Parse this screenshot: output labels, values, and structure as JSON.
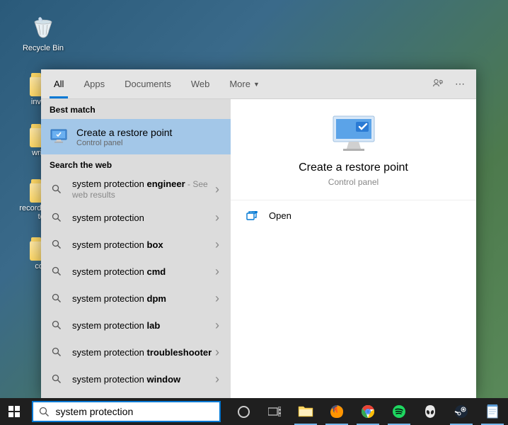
{
  "desktop": {
    "recycle_bin": "Recycle Bin",
    "folders": [
      "invoice",
      "writing",
      "recording and tes",
      "copy"
    ]
  },
  "tabs": {
    "items": [
      "All",
      "Apps",
      "Documents",
      "Web",
      "More"
    ],
    "active": 0
  },
  "sections": {
    "best_match": "Best match",
    "web": "Search the web"
  },
  "best_match": {
    "title": "Create a restore point",
    "subtitle": "Control panel"
  },
  "web_results": [
    {
      "prefix": "system protection ",
      "bold": "engineer",
      "note": " - See web results"
    },
    {
      "prefix": "system protection",
      "bold": "",
      "note": ""
    },
    {
      "prefix": "system protection ",
      "bold": "box",
      "note": ""
    },
    {
      "prefix": "system protection ",
      "bold": "cmd",
      "note": ""
    },
    {
      "prefix": "system protection ",
      "bold": "dpm",
      "note": ""
    },
    {
      "prefix": "system protection ",
      "bold": "lab",
      "note": ""
    },
    {
      "prefix": "system protection ",
      "bold": "troubleshooter",
      "note": ""
    },
    {
      "prefix": "system protection ",
      "bold": "window",
      "note": ""
    }
  ],
  "preview": {
    "title": "Create a restore point",
    "subtitle": "Control panel"
  },
  "actions": {
    "open": "Open"
  },
  "search": {
    "value": "system protection"
  }
}
